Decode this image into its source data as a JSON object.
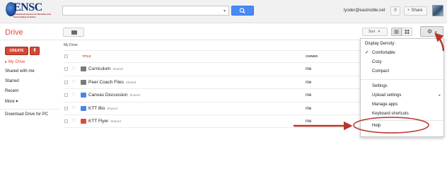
{
  "logo": {
    "title": "ENSC",
    "subtitle": "Educational Service for Nicholas and Surrounding Counties"
  },
  "search": {
    "value": "",
    "caret": "▾"
  },
  "user": {
    "email": "lyoder@eastnoble.net",
    "count": "0",
    "share_label": "Share",
    "share_plus": "+"
  },
  "drive": {
    "title": "Drive",
    "sort_label": "Sort",
    "sort_caret": "▾",
    "settings_glyph": "⚙",
    "settings_caret": "▾"
  },
  "sidebar": {
    "create_label": "CREATE",
    "upload_glyph": "⬆",
    "items": [
      {
        "label": "My Drive",
        "prefix": "▸ ",
        "active": true
      },
      {
        "label": "Shared with me"
      },
      {
        "label": "Starred"
      },
      {
        "label": "Recent"
      },
      {
        "label": "More",
        "suffix": " ▾"
      },
      {
        "label": "Download Drive for PC"
      }
    ]
  },
  "list": {
    "breadcrumb": "My Drive",
    "columns": {
      "title": "TITLE",
      "owner": "OWNER"
    },
    "rows": [
      {
        "name": "Curriculum",
        "badge": "Shared",
        "owner": "me",
        "icon": "shared-folder-icon"
      },
      {
        "name": "Peer Coach Files",
        "badge": "Shared",
        "owner": "me",
        "icon": "shared-folder-icon"
      },
      {
        "name": "Canvas Discussion",
        "badge": "Shared",
        "owner": "me",
        "icon": "document-icon"
      },
      {
        "name": "KTT Bio",
        "badge": "Shared",
        "owner": "me",
        "icon": "document-icon"
      },
      {
        "name": "KTT Flyer",
        "badge": "Shared",
        "owner": "me",
        "icon": "pdf-icon"
      }
    ],
    "star_glyph": "☆"
  },
  "settings_menu": {
    "heading": "Display Density:",
    "check_glyph": "✓",
    "submenu_glyph": "▸",
    "density": [
      "Comfortable",
      "Cozy",
      "Compact"
    ],
    "items": [
      "Settings",
      "Upload settings",
      "Manage apps",
      "Keyboard shortcuts"
    ],
    "help": "Help"
  },
  "colors": {
    "brand_red": "#dd4b39",
    "create_red": "#d14836",
    "search_blue": "#4a8af4",
    "annotation_red": "#b8342b"
  }
}
